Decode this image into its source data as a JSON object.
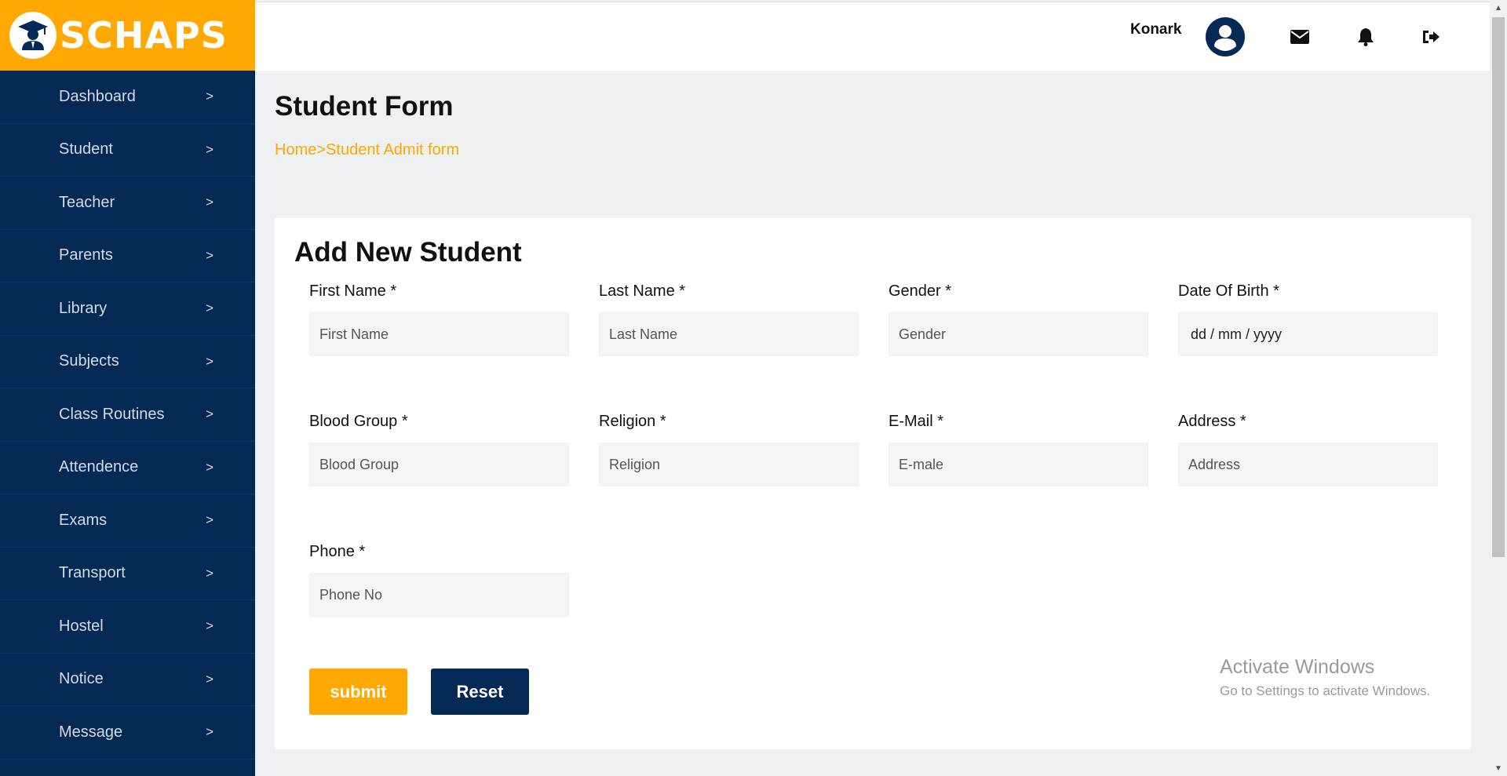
{
  "brand": {
    "name": "SCHAPS",
    "accent_color": "#ffa801",
    "navy_color": "#042954"
  },
  "sidebar": {
    "chevron": ">",
    "items": [
      {
        "label": "Dashboard"
      },
      {
        "label": "Student"
      },
      {
        "label": "Teacher"
      },
      {
        "label": "Parents"
      },
      {
        "label": "Library"
      },
      {
        "label": "Subjects"
      },
      {
        "label": "Class Routines"
      },
      {
        "label": "Attendence"
      },
      {
        "label": "Exams"
      },
      {
        "label": "Transport"
      },
      {
        "label": "Hostel"
      },
      {
        "label": "Notice"
      },
      {
        "label": "Message"
      }
    ]
  },
  "header": {
    "user_name": "Konark",
    "icons": [
      "avatar-icon",
      "envelope-icon",
      "bell-icon",
      "sign-out-icon"
    ]
  },
  "page": {
    "title": "Student Form",
    "breadcrumb": {
      "home": "Home",
      "separator": ">",
      "current": "Student Admit form"
    }
  },
  "form": {
    "title": "Add New Student",
    "fields": {
      "first_name": {
        "label": "First Name *",
        "placeholder": "First Name"
      },
      "last_name": {
        "label": "Last Name *",
        "placeholder": "Last Name"
      },
      "gender": {
        "label": "Gender *",
        "placeholder": "Gender"
      },
      "dob": {
        "label": "Date Of Birth *",
        "value": "dd / mm / yyyy"
      },
      "blood_group": {
        "label": "Blood Group *",
        "placeholder": "Blood Group"
      },
      "religion": {
        "label": "Religion *",
        "placeholder": "Religion"
      },
      "email": {
        "label": "E-Mail *",
        "placeholder": "E-male"
      },
      "address": {
        "label": "Address *",
        "placeholder": "Address"
      },
      "phone": {
        "label": "Phone *",
        "placeholder": "Phone No"
      }
    },
    "submit_label": "submit",
    "reset_label": "Reset"
  },
  "watermark": {
    "title": "Activate Windows",
    "subtitle": "Go to Settings to activate Windows."
  }
}
